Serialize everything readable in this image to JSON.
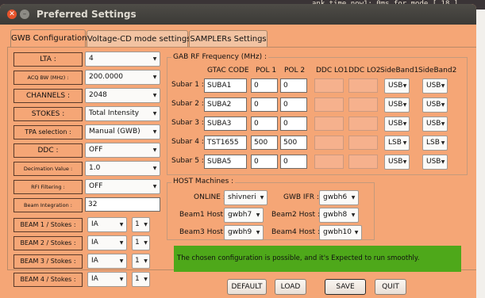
{
  "background": {
    "terminal_text": "ank time now1: 0ms  for mode [ 18 ]"
  },
  "window": {
    "title": "Preferred Settings"
  },
  "tabs": [
    "GWB Configuration",
    "Voltage-CD mode settings",
    "SAMPLERs Settings"
  ],
  "settings": [
    {
      "label": "LTA :",
      "value": "4"
    },
    {
      "label": "ACQ BW (MHz) :",
      "value": "200.0000"
    },
    {
      "label": "CHANNELS :",
      "value": "2048"
    },
    {
      "label": "STOKES :",
      "value": "Total Intensity"
    },
    {
      "label": "TPA selection :",
      "value": "Manual (GWB)"
    },
    {
      "label": "DDC :",
      "value": "OFF"
    },
    {
      "label": "Decimation Value :",
      "value": "1.0"
    },
    {
      "label": "RFI Filtering :",
      "value": "OFF"
    },
    {
      "label": "Beam Integration :",
      "value": "32"
    }
  ],
  "beams": [
    {
      "label": "BEAM 1 / Stokes :",
      "mode": "IA",
      "stokes": "1"
    },
    {
      "label": "BEAM 2 / Stokes :",
      "mode": "IA",
      "stokes": "1"
    },
    {
      "label": "BEAM 3 / Stokes :",
      "mode": "IA",
      "stokes": "1"
    },
    {
      "label": "BEAM 4 / Stokes :",
      "mode": "IA",
      "stokes": "1"
    }
  ],
  "rf": {
    "title": "GAB RF Frequency (MHz) :",
    "headers": [
      "GTAC CODE",
      "POL 1",
      "POL 2",
      "DDC LO1",
      "DDC LO2",
      "SideBand1",
      "SideBand2"
    ],
    "rows": [
      {
        "label": "Subar 1 :",
        "code": "SUBA1",
        "pol1": "0",
        "pol2": "0",
        "ddc1": "",
        "ddc2": "",
        "sb1": "USB",
        "sb2": "USB"
      },
      {
        "label": "Subar 2 :",
        "code": "SUBA2",
        "pol1": "0",
        "pol2": "0",
        "ddc1": "",
        "ddc2": "",
        "sb1": "USB",
        "sb2": "USB"
      },
      {
        "label": "Subar 3 :",
        "code": "SUBA3",
        "pol1": "0",
        "pol2": "0",
        "ddc1": "",
        "ddc2": "",
        "sb1": "USB",
        "sb2": "USB"
      },
      {
        "label": "Subar 4 :",
        "code": "TST1655",
        "pol1": "500",
        "pol2": "500",
        "ddc1": "",
        "ddc2": "",
        "sb1": "LSB",
        "sb2": "LSB"
      },
      {
        "label": "Subar 5 :",
        "code": "SUBA5",
        "pol1": "0",
        "pol2": "0",
        "ddc1": "",
        "ddc2": "",
        "sb1": "USB",
        "sb2": "USB"
      }
    ]
  },
  "host": {
    "title": "HOST Machines :",
    "online_label": "ONLINE :",
    "online_value": "shivneri",
    "gwbifr_label": "GWB IFR :",
    "gwbifr_value": "gwbh6",
    "beam1_label": "Beam1 Host :",
    "beam1_value": "gwbh7",
    "beam2_label": "Beam2 Host :",
    "beam2_value": "gwbh8",
    "beam3_label": "Beam3 Host :",
    "beam3_value": "gwbh9",
    "beam4_label": "Beam4 Host :",
    "beam4_value": "gwbh10"
  },
  "status": {
    "message": "The chosen configuration is possible, and it's Expected to run smoothly.",
    "color": "#4ea81a"
  },
  "buttons": {
    "default": "DEFAULT",
    "load": "LOAD",
    "save": "SAVE",
    "quit": "QUIT"
  },
  "icons": {
    "dropdown": "▼",
    "close": "✕",
    "minimize": "–"
  }
}
